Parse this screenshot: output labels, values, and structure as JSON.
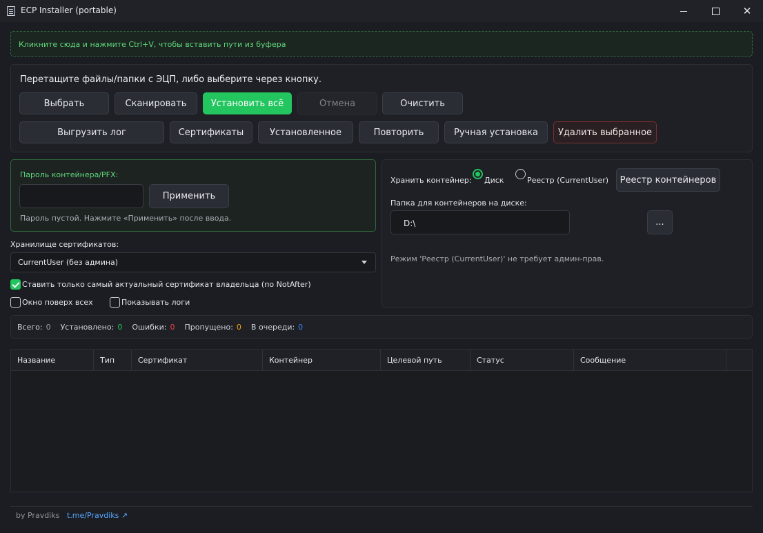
{
  "window": {
    "title": "ECP Installer (portable)",
    "minimize": "—",
    "maximize": "☐",
    "close": "✕"
  },
  "paste_hint": "Кликните сюда и нажмите Ctrl+V, чтобы вставить пути из буфера",
  "drop": {
    "title": "Перетащите файлы/папки с ЭЦП, либо выберите через кнопку.",
    "buttons": {
      "select": "Выбрать",
      "scan": "Сканировать",
      "install_all": "Установить всё",
      "cancel": "Отмена",
      "clear": "Очистить",
      "export_log": "Выгрузить лог",
      "certificates": "Сертификаты",
      "installed": "Установленное",
      "retry": "Повторить",
      "manual_install": "Ручная установка",
      "delete_selected": "Удалить выбранное"
    }
  },
  "password": {
    "label": "Пароль контейнера/PFX:",
    "value": "",
    "apply": "Применить",
    "note": "Пароль пустой. Нажмите «Применить» после ввода."
  },
  "store": {
    "label": "Хранилище сертификатов:",
    "selected": "CurrentUser (без админа)"
  },
  "options": {
    "latest_only": "Ставить только самый актуальный сертификат владельца (по NotAfter)",
    "latest_only_checked": true,
    "on_top": "Окно поверх всех",
    "on_top_checked": false,
    "show_logs": "Показывать логи",
    "show_logs_checked": false
  },
  "container": {
    "store_label": "Хранить контейнер:",
    "disk": "Диск",
    "registry": "Реестр (CurrentUser)",
    "selected": "disk",
    "registry_button": "Реестр контейнеров",
    "folder_label": "Папка для контейнеров на диске:",
    "folder_value": "D:\\",
    "browse": "...",
    "note": "Режим 'Реестр (CurrentUser)' не требует админ-прав."
  },
  "stats": {
    "total_label": "Всего:",
    "total": "0",
    "installed_label": "Установлено:",
    "installed": "0",
    "errors_label": "Ошибки:",
    "errors": "0",
    "skipped_label": "Пропущено:",
    "skipped": "0",
    "queued_label": "В очереди:",
    "queued": "0",
    "colors": {
      "total": "#9aa0a8",
      "installed": "#22c55e",
      "errors": "#ef4444",
      "skipped": "#f59e0b",
      "queued": "#3b82f6"
    }
  },
  "table": {
    "columns": [
      "Название",
      "Тип",
      "Сертификат",
      "Контейнер",
      "Целевой путь",
      "Статус",
      "Сообщение"
    ],
    "rows": []
  },
  "footer": {
    "by": "by Pravdiks",
    "link": "t.me/Pravdiks ↗"
  }
}
